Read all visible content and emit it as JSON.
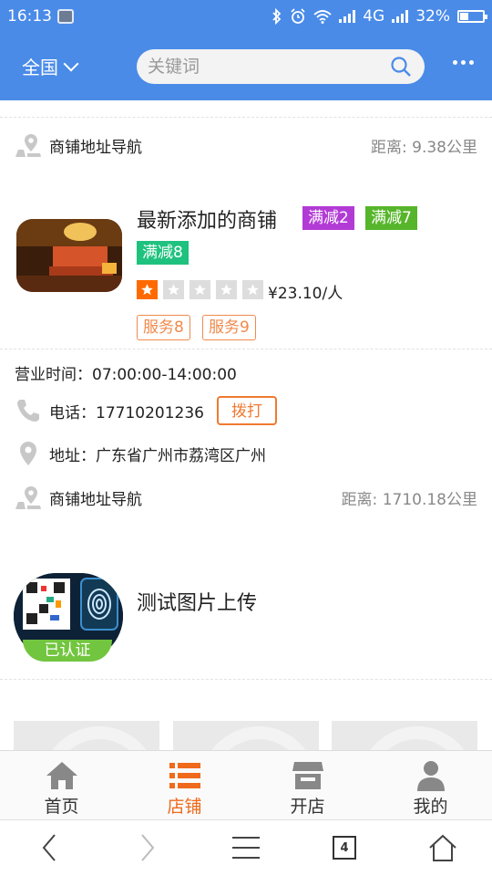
{
  "status_bar": {
    "time": "16:13",
    "network": "4G",
    "battery": "32%"
  },
  "header": {
    "region": "全国",
    "search_placeholder": "关键词"
  },
  "top_nav": {
    "label": "商铺地址导航",
    "distance": "距离: 9.38公里"
  },
  "shop1": {
    "title": "最新添加的商铺",
    "tags": [
      {
        "label": "满减2",
        "color": "#b23bd6"
      },
      {
        "label": "满减7",
        "color": "#57b52b"
      },
      {
        "label": "满减8",
        "color": "#1ec27e"
      }
    ],
    "rating": 1,
    "rating_max": 5,
    "price": "¥23.10/人",
    "services": [
      "服务8",
      "服务9"
    ],
    "hours": "营业时间：07:00:00-14:00:00",
    "phone": "电话：17710201236",
    "call_label": "拨打",
    "address": "地址：广东省广州市荔湾区广州",
    "nav_label": "商铺地址导航",
    "distance": "距离: 1710.18公里"
  },
  "shop2": {
    "title": "测试图片上传",
    "verified": "已认证"
  },
  "tabbar": {
    "items": [
      {
        "label": "首页",
        "icon": "home-icon",
        "active": false
      },
      {
        "label": "店铺",
        "icon": "list-icon",
        "active": true
      },
      {
        "label": "开店",
        "icon": "store-icon",
        "active": false
      },
      {
        "label": "我的",
        "icon": "user-icon",
        "active": false
      }
    ]
  },
  "sysnav": {
    "tab_count": "4"
  },
  "colors": {
    "header_blue": "#4a8be8",
    "accent_orange": "#ef6a1a",
    "star_orange": "#ff6a00"
  }
}
